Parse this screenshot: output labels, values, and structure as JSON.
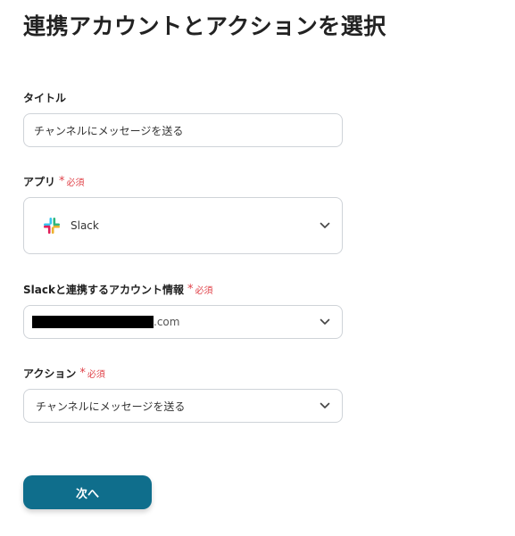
{
  "page": {
    "title": "連携アカウントとアクションを選択"
  },
  "fields": {
    "title": {
      "label": "タイトル",
      "value": "チャンネルにメッセージを送る"
    },
    "app": {
      "label": "アプリ",
      "required_label": "必須",
      "value": "Slack",
      "icon": "slack-logo-icon"
    },
    "account": {
      "label": "Slackと連携するアカウント情報",
      "required_label": "必須",
      "value_suffix": ".com"
    },
    "action": {
      "label": "アクション",
      "required_label": "必須",
      "value": "チャンネルにメッセージを送る"
    }
  },
  "actions": {
    "next_label": "次へ"
  },
  "colors": {
    "primary_button": "#0f6e8c",
    "required": "#e0434a",
    "border": "#cfd3d8"
  }
}
